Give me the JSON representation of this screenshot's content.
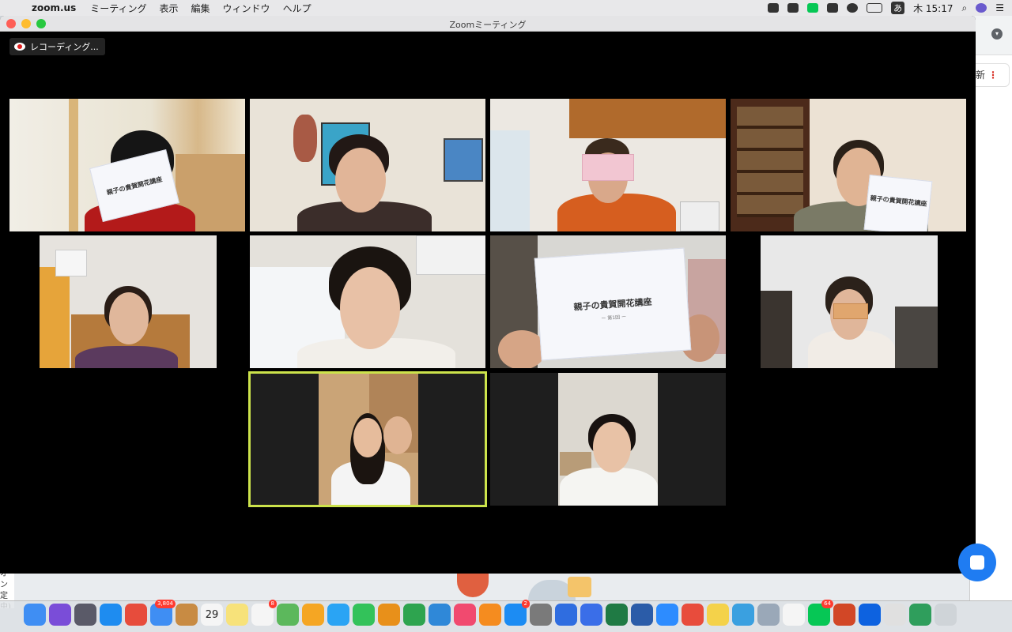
{
  "menubar": {
    "apple_icon": "apple-logo",
    "app_name": "zoom.us",
    "menus": [
      "ミーティング",
      "表示",
      "編集",
      "ウィンドウ",
      "ヘルプ"
    ],
    "ime": "あ",
    "clock": "木 15:17"
  },
  "zoom": {
    "window_title": "Zoomミーティング",
    "recording_label": "レコーディング..."
  },
  "tiles": [
    {
      "id": "p1",
      "paper_title": "親子の貴賀開花講座"
    },
    {
      "id": "p7",
      "paper_title": "親子の貴賀開花講座",
      "paper_sub": "ー 第1回 ー"
    },
    {
      "id": "p4",
      "paper_title": "親子の貴賀開花講座"
    }
  ],
  "background": {
    "pill_text": "新",
    "left_text": "オン\n定中)\nラ"
  },
  "dock": {
    "apps": [
      "Finder",
      "Siri",
      "Launchpad",
      "Safari",
      "Chrome",
      "Preview",
      "Contacts",
      "Calendar",
      "Notes",
      "Reminders",
      "Maps",
      "Photos",
      "Messages",
      "FaceTime",
      "Pages",
      "Numbers",
      "Keynote",
      "Music",
      "Books",
      "App Store",
      "System Preferences",
      "Zoom Share",
      "Zoom Contacts",
      "Excel",
      "Word",
      "Zoom",
      "LINE Store",
      "Stickies",
      "Network",
      "Image Capture",
      "Text Editor",
      "LINE",
      "PowerPoint",
      "Dropbox",
      "Keyboard",
      "Numbers Doc",
      "Trash"
    ],
    "calendar_day": "29",
    "badges": {
      "Preview": "3,804",
      "Reminders": "8",
      "App Store": "2",
      "LINE": "64"
    }
  }
}
